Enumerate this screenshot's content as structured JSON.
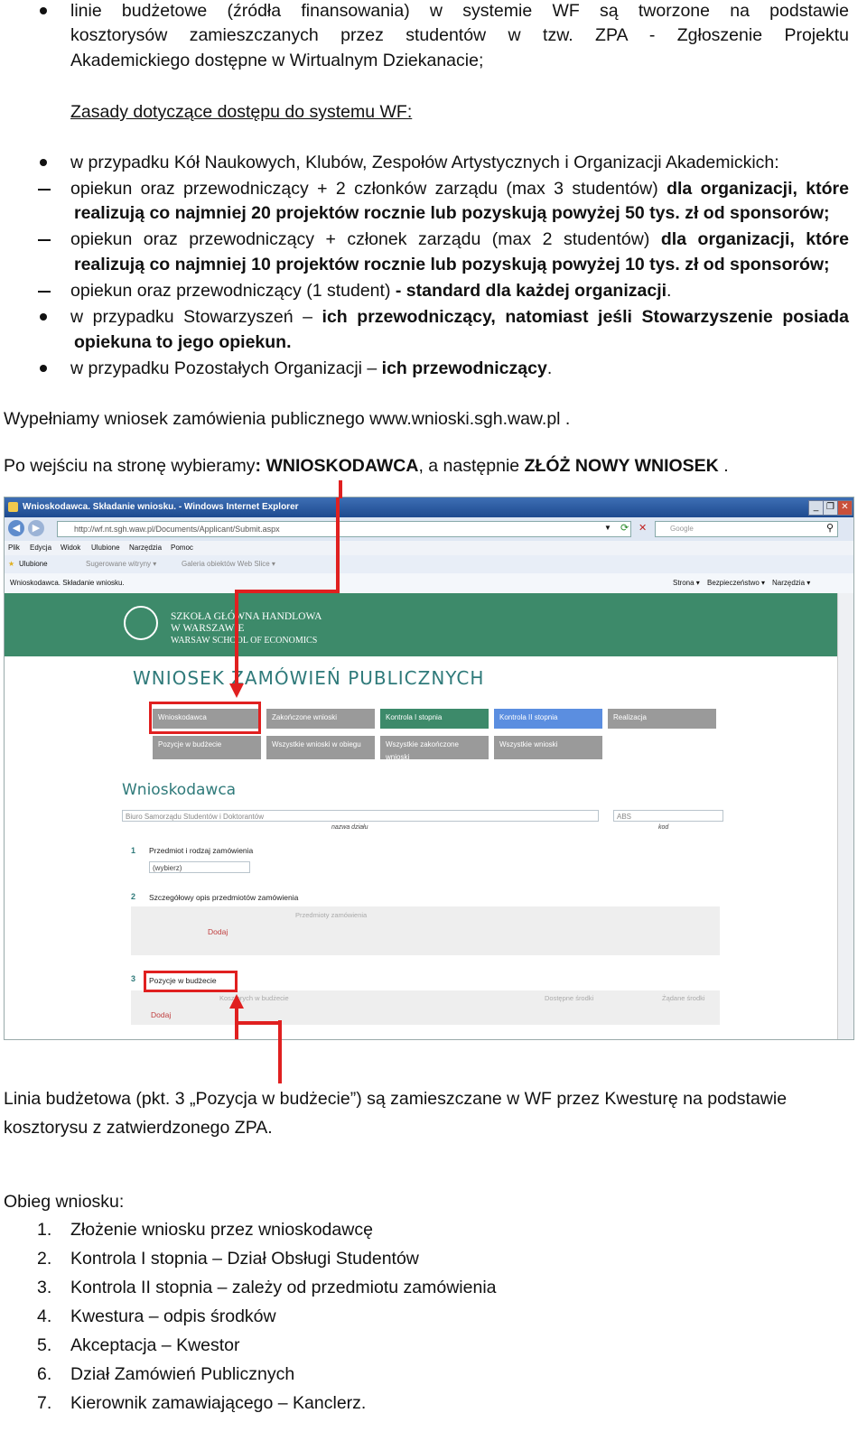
{
  "bullets_top": {
    "item1_line1": "linie budżetowe (źródła finansowania) w systemie WF są tworzone na podstawie",
    "item1_line2": "kosztorysów zamieszczanych przez studentów w tzw. ZPA - Zgłoszenie Projektu",
    "item1_line3": "Akademickiego dostępne w Wirtualnym Dziekanacie;"
  },
  "access_heading": "Zasady dotyczące dostępu do systemu WF:",
  "access": {
    "kola": "w przypadku Kół Naukowych, Klubów, Zespołów Artystycznych i Organizacji Akademickich:",
    "dash1_a": "opiekun oraz przewodniczący + 2 członków zarządu (max 3 studentów)",
    "dash1_b": "dla organizacji, które",
    "dash1_c": "realizują co najmniej 20 projektów rocznie lub pozyskują powyżej 50 tys. zł od sponsorów;",
    "dash2_a": "opiekun oraz przewodniczący + członek zarządu (max 2 studentów)",
    "dash2_b": "dla organizacji, które",
    "dash2_c": "realizują co najmniej 10 projektów rocznie lub pozyskują powyżej 10 tys. zł od sponsorów;",
    "dash3_a": "opiekun oraz przewodniczący (1 student)",
    "dash3_b": "- standard dla każdej organizacji",
    "dash3_c": ".",
    "stow_a": "w przypadku Stowarzyszeń –",
    "stow_b": "ich przewodniczący, natomiast jeśli Stowarzyszenie posiada",
    "stow_c": "opiekuna to jego opiekun.",
    "poz_a": "w przypadku Pozostałych Organizacji –",
    "poz_b": "ich przewodniczący",
    "poz_c": "."
  },
  "para1": "Wypełniamy wniosek zamówienia publicznego www.wnioski.sgh.waw.pl .",
  "para2": {
    "a": "Po wejściu na stronę wybieramy",
    "b": ": WNIOSKODAWCA",
    "c": ", a następnie",
    "d": "ZŁÓŻ NOWY WNIOSEK",
    "e": "."
  },
  "screenshot": {
    "window_title": "Wnioskodawca. Składanie wniosku. - Windows Internet Explorer",
    "url": "http://wf.nt.sgh.waw.pl/Documents/Applicant/Submit.aspx",
    "search_placeholder": "Google",
    "menu": [
      "Plik",
      "Edycja",
      "Widok",
      "Ulubione",
      "Narzędzia",
      "Pomoc"
    ],
    "fav_label": "Ulubione",
    "fav_items": [
      "Sugerowane witryny ▾",
      "Galeria obiektów Web Slice ▾"
    ],
    "tab_title": "Wnioskodawca. Składanie wniosku.",
    "toolbar_right": [
      "Strona ▾",
      "Bezpieczeństwo ▾",
      "Narzędzia ▾"
    ],
    "logo_line1": "SZKOŁA GŁÓWNA HANDLOWA",
    "logo_line2": "W WARSZAWIE",
    "logo_line3": "WARSAW SCHOOL OF ECONOMICS",
    "page_title": "WNIOSEK ZAMÓWIEŃ PUBLICZNYCH",
    "tabs_row1": [
      "Wnioskodawca",
      "Zakończone wnioski",
      "Kontrola I stopnia",
      "Kontrola II stopnia",
      "Realizacja"
    ],
    "tabs_row2": [
      "Pozycje w budżecie",
      "Wszystkie wnioski w obiegu",
      "Wszystkie zakończone wnioski",
      "Wszystkie wnioski"
    ],
    "section_title": "Wnioskodawca",
    "unit_value": "Biuro Samorządu Studentów i Doktorantów",
    "unit_label": "nazwa działu",
    "code_value": "ABS",
    "code_label": "kod",
    "s1_num": "1",
    "s1_label": "Przedmiot i rodzaj zamówienia",
    "s1_select": "(wybierz)",
    "s2_num": "2",
    "s2_label": "Szczegółowy opis przedmiotów zamówienia",
    "s2_col": "Przedmioty zamówienia",
    "s2_add": "Dodaj",
    "s3_num": "3",
    "s3_label": "Pozycje w budżecie",
    "s3_cols": [
      "Kosztorych w budżecie",
      "Dostępne środki",
      "Żądane środki"
    ],
    "s3_add": "Dodaj"
  },
  "para3_line1": "Linia budżetowa (pkt. 3 „Pozycja w budżecie”) są zamieszczane w WF przez Kwesturę na podstawie",
  "para3_line2": "kosztorysu z zatwierdzonego ZPA.",
  "flow_heading": "Obieg wniosku:",
  "flow": [
    {
      "n": "1.",
      "t": "Złożenie wniosku przez wnioskodawcę"
    },
    {
      "n": "2.",
      "t": "Kontrola I stopnia – Dział Obsługi Studentów"
    },
    {
      "n": "3.",
      "t": "Kontrola II stopnia – zależy od przedmiotu zamówienia"
    },
    {
      "n": "4.",
      "t": "Kwestura – odpis środków"
    },
    {
      "n": "5.",
      "t": "Akceptacja – Kwestor"
    },
    {
      "n": "6.",
      "t": "Dział Zamówień Publicznych"
    },
    {
      "n": "7.",
      "t": "Kierownik zamawiającego – Kanclerz."
    }
  ]
}
